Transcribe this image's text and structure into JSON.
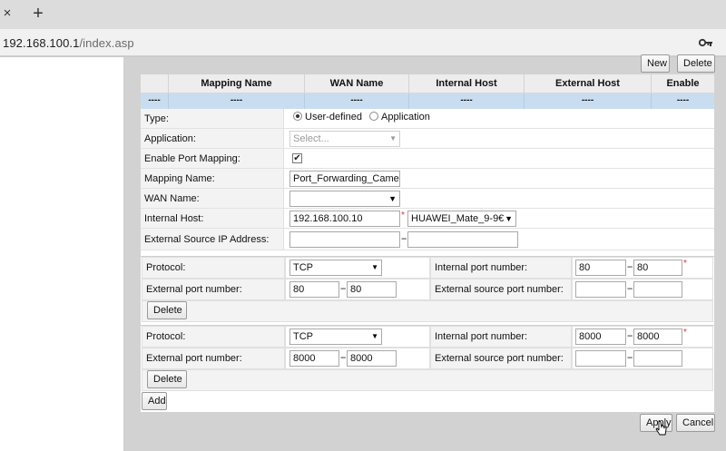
{
  "browser": {
    "close_glyph": "×",
    "new_tab_glyph": "+",
    "url_host": "192.168.100.1",
    "url_path": "/index.asp"
  },
  "toolbar": {
    "new_label": "New",
    "delete_label": "Delete"
  },
  "table": {
    "headers": [
      "Mapping Name",
      "WAN Name",
      "Internal Host",
      "External Host",
      "Enable"
    ],
    "summary": [
      "----",
      "----",
      "----",
      "----",
      "----",
      "----"
    ]
  },
  "form": {
    "type_label": "Type:",
    "type_opt1": "User-defined",
    "type_opt2": "Application",
    "application_label": "Application:",
    "application_placeholder": "Select...",
    "enable_label": "Enable Port Mapping:",
    "enable_checked": true,
    "mapping_name_label": "Mapping Name:",
    "mapping_name_value": "Port_Forwarding_Camer",
    "wan_name_label": "WAN Name:",
    "wan_name_value": "",
    "internal_host_label": "Internal Host:",
    "internal_host_value": "192.168.100.10",
    "internal_host_device": "HUAWEI_Mate_9-9€",
    "ext_source_ip_label": "External Source IP Address:",
    "ext_source_ip_start": "",
    "ext_source_ip_end": ""
  },
  "port_labels": {
    "protocol": "Protocol:",
    "internal_port": "Internal port number:",
    "external_port": "External port number:",
    "external_source_port": "External source port number:",
    "delete": "Delete",
    "required": "*",
    "range_sep": "--"
  },
  "port_mappings": [
    {
      "protocol": "TCP",
      "internal_start": "80",
      "internal_end": "80",
      "external_start": "80",
      "external_end": "80",
      "ext_source_start": "",
      "ext_source_end": ""
    },
    {
      "protocol": "TCP",
      "internal_start": "8000",
      "internal_end": "8000",
      "external_start": "8000",
      "external_end": "8000",
      "ext_source_start": "",
      "ext_source_end": ""
    }
  ],
  "actions": {
    "add_label": "Add",
    "apply_label": "Apply",
    "cancel_label": "Cancel"
  }
}
